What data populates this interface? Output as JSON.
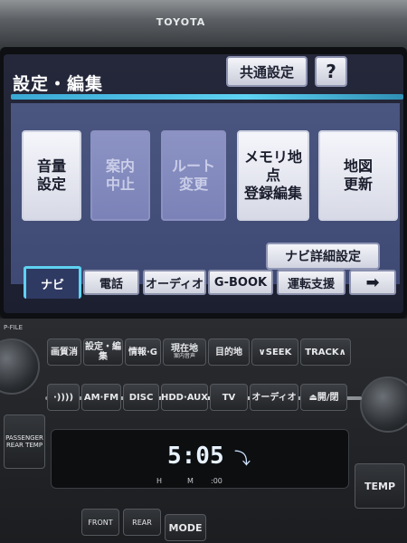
{
  "device": {
    "brand": "TOYOTA"
  },
  "screen": {
    "title": "設定・編集",
    "common_settings_label": "共通設定",
    "help_label": "?",
    "tiles": [
      {
        "label": "音量\n設定",
        "enabled": true
      },
      {
        "label": "案内\n中止",
        "enabled": false
      },
      {
        "label": "ルート\n変更",
        "enabled": false
      },
      {
        "label": "メモリ地点\n登録編集",
        "enabled": true
      },
      {
        "label": "地図\n更新",
        "enabled": true
      }
    ],
    "detail_settings_label": "ナビ詳細設定",
    "tabs": [
      {
        "label": "ナビ",
        "active": true
      },
      {
        "label": "電話",
        "active": false
      },
      {
        "label": "オーディオ",
        "active": false
      },
      {
        "label": "G-BOOK",
        "active": false
      },
      {
        "label": "運転支援",
        "active": false
      },
      {
        "label": "➡",
        "active": false
      }
    ]
  },
  "controls": {
    "strip_label": "P-FILE",
    "row1": [
      {
        "label": "画質消",
        "sub": ""
      },
      {
        "label": "設定・編集",
        "sub": ""
      },
      {
        "label": "情報·G",
        "sub": ""
      },
      {
        "label": "現在地",
        "sub": "案内音声"
      },
      {
        "label": "目的地",
        "sub": ""
      },
      {
        "label": "∨SEEK",
        "sub": ""
      },
      {
        "label": "TRACK∧",
        "sub": ""
      }
    ],
    "row2": [
      {
        "label": "·))))",
        "sub": ""
      },
      {
        "label": "AM·FM",
        "sub": ""
      },
      {
        "label": "DISC",
        "sub": ""
      },
      {
        "label": "HDD·AUX",
        "sub": ""
      },
      {
        "label": "TV",
        "sub": ""
      },
      {
        "label": "オーディオ",
        "sub": ""
      },
      {
        "label": "⏏開/閉",
        "sub": ""
      }
    ],
    "clock": "5:05",
    "lcd_marks": [
      "H",
      "M",
      ":00"
    ],
    "left_labels": {
      "temp": "PASSENGER REAR TEMP"
    },
    "bottom": [
      {
        "label": "FRONT"
      },
      {
        "label": "REAR"
      },
      {
        "label": "MODE"
      },
      {
        "label": "TEMP"
      }
    ]
  }
}
